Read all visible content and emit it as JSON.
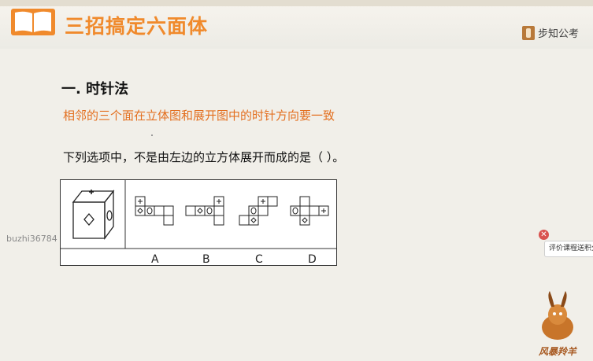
{
  "header": {
    "title": "三招搞定六面体",
    "brand": "步知公考",
    "book_icon": "open-book-icon"
  },
  "content": {
    "heading": "一. 时针法",
    "subheading": "相邻的三个面在立体图和展开图中的时针方向要一致",
    "question": "下列选项中，不是由左边的立方体展开而成的是（    ）。",
    "options": [
      "A",
      "B",
      "C",
      "D"
    ]
  },
  "watermark": "buzhi36784",
  "rate_button": {
    "label": "评价课程送积分"
  },
  "mascot": {
    "label": "风暴羚羊"
  },
  "colors": {
    "accent": "#f08a2c",
    "subheading": "#e36f1f"
  }
}
